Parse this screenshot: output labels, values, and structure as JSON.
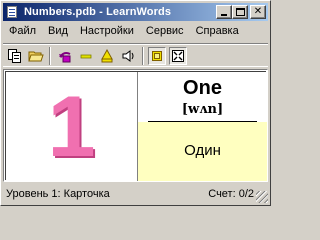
{
  "window": {
    "title": "Numbers.pdb - LearnWords"
  },
  "menu": {
    "items": [
      "Файл",
      "Вид",
      "Настройки",
      "Сервис",
      "Справка"
    ]
  },
  "toolbar": {
    "tools": [
      "copy-icon",
      "open-folder-icon",
      "card-flip-icon",
      "minus-icon",
      "warning-icon",
      "sound-icon",
      "card-mode-icon",
      "fullscreen-icon"
    ]
  },
  "card": {
    "picture_text": "1",
    "word": "One",
    "transcription": "[wʌn]",
    "translation": "Один",
    "translation_bg": "#ffffc0",
    "number_color": "#f070b0"
  },
  "status": {
    "left": "Уровень 1: Карточка",
    "right": "Счет: 0/2"
  }
}
